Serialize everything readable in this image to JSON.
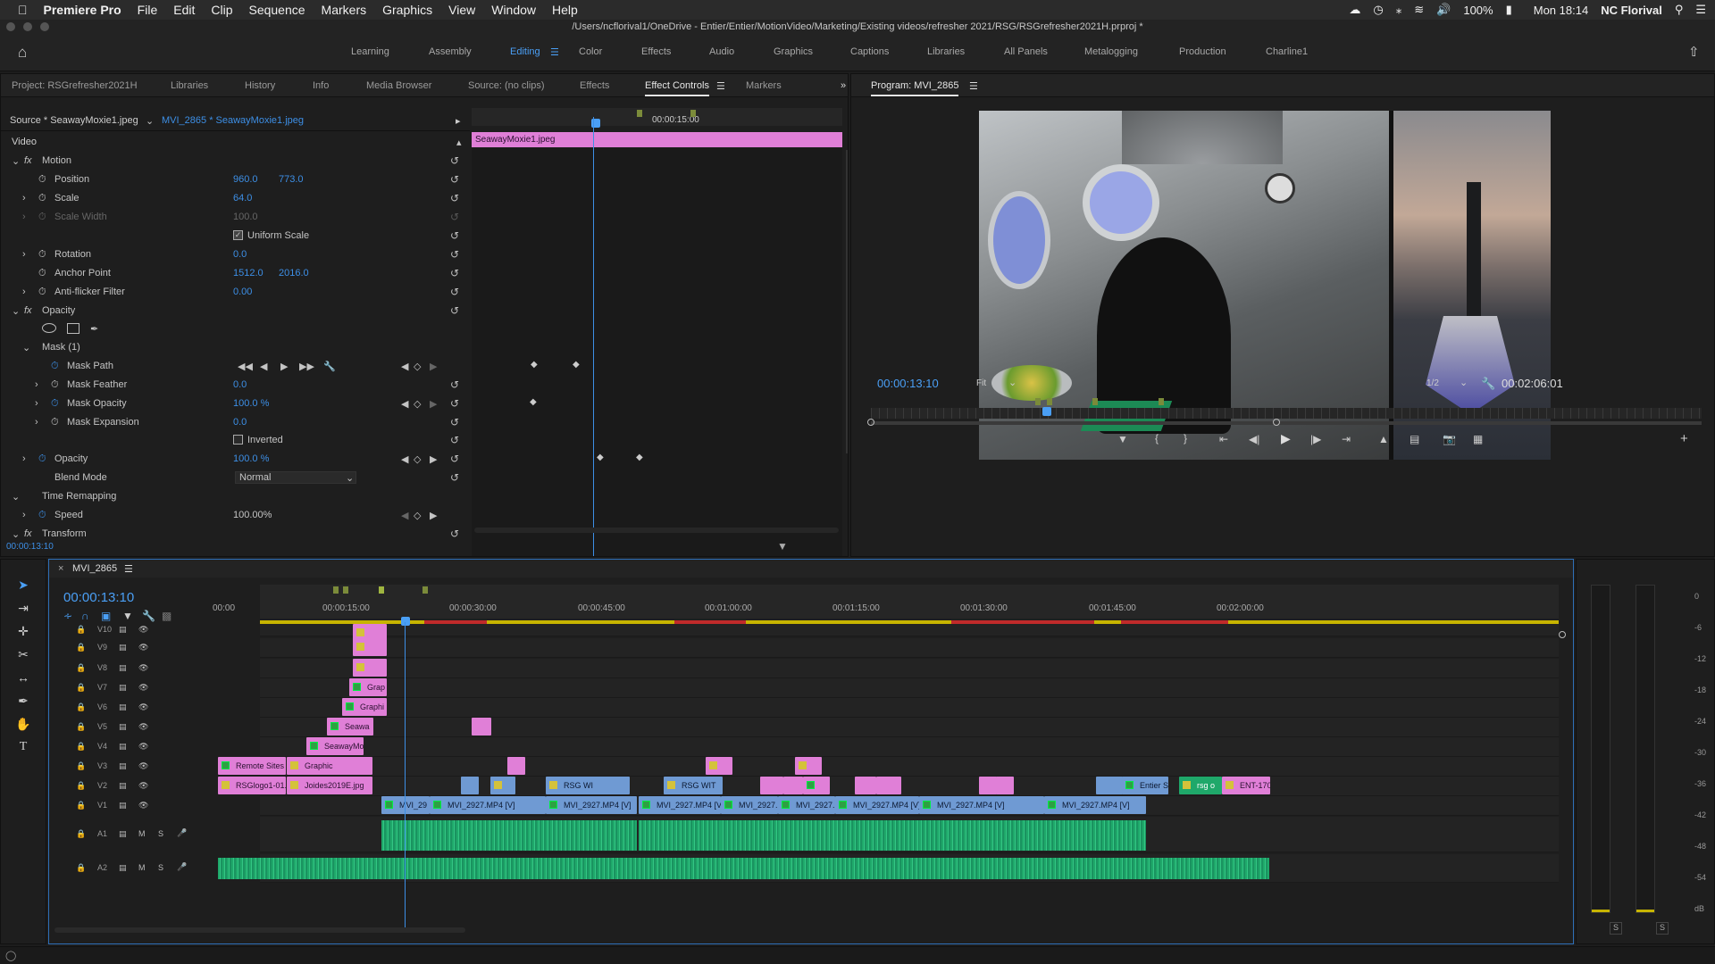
{
  "menubar": {
    "app": "Premiere Pro",
    "items": [
      "File",
      "Edit",
      "Clip",
      "Sequence",
      "Markers",
      "Graphics",
      "View",
      "Window",
      "Help"
    ],
    "battery": "100%",
    "clock": "Mon 18:14",
    "user": "NC Florival"
  },
  "titlebar": {
    "path": "/Users/ncflorival1/OneDrive - Entier/Entier/MotionVideo/Marketing/Existing videos/refresher 2021/RSG/RSGrefresher2021H.prproj *"
  },
  "workspaces": [
    "Learning",
    "Assembly",
    "Editing",
    "Color",
    "Effects",
    "Audio",
    "Graphics",
    "Captions",
    "Libraries",
    "All Panels",
    "Metalogging",
    "Production",
    "Charline1"
  ],
  "workspace_active": "Editing",
  "left_tabs": [
    "Project: RSGrefresher2021H",
    "Libraries",
    "History",
    "Info",
    "Media Browser",
    "Source: (no clips)",
    "Effects",
    "Effect Controls",
    "Markers"
  ],
  "left_tab_active": "Effect Controls",
  "effect_controls": {
    "source_label": "Source * SeawayMoxie1.jpeg",
    "sequence_clip": "MVI_2865 * SeawayMoxie1.jpeg",
    "timecode_head": "00:00:15:00",
    "clip_name": "SeawayMoxie1.jpeg",
    "video_label": "Video",
    "motion": "Motion",
    "position_label": "Position",
    "position_x": "960.0",
    "position_y": "773.0",
    "scale_label": "Scale",
    "scale": "64.0",
    "scale_width_label": "Scale Width",
    "scale_width": "100.0",
    "uniform_scale": "Uniform Scale",
    "rotation_label": "Rotation",
    "rotation": "0.0",
    "anchor_label": "Anchor Point",
    "anchor_x": "1512.0",
    "anchor_y": "2016.0",
    "antiflicker_label": "Anti-flicker Filter",
    "antiflicker": "0.00",
    "opacity_section": "Opacity",
    "mask_label": "Mask (1)",
    "mask_path": "Mask Path",
    "mask_feather_label": "Mask Feather",
    "mask_feather": "0.0",
    "mask_opacity_label": "Mask Opacity",
    "mask_opacity": "100.0 %",
    "mask_expansion_label": "Mask Expansion",
    "mask_expansion": "0.0",
    "inverted": "Inverted",
    "opacity_label": "Opacity",
    "opacity": "100.0 %",
    "blend_label": "Blend Mode",
    "blend": "Normal",
    "time_remap": "Time Remapping",
    "speed_label": "Speed",
    "speed": "100.00%",
    "transform": "Transform",
    "current_time": "00:00:13:10"
  },
  "program": {
    "title": "Program: MVI_2865",
    "timecode": "00:00:13:10",
    "fit": "Fit",
    "resolution": "1/2",
    "duration": "00:02:06:01"
  },
  "timeline": {
    "sequence": "MVI_2865",
    "timecode": "00:00:13:10",
    "ruler": [
      "00:00",
      "00:00:15:00",
      "00:00:30:00",
      "00:00:45:00",
      "00:01:00:00",
      "00:01:15:00",
      "00:01:30:00",
      "00:01:45:00",
      "00:02:00:00"
    ],
    "tracks": [
      "V10",
      "V9",
      "V8",
      "V7",
      "V6",
      "V5",
      "V4",
      "V3",
      "V2",
      "V1",
      "A1",
      "A2"
    ],
    "clips": {
      "grap": "Grap",
      "graphi": "Graphi",
      "seawa": "Seawa",
      "seawaymo": "SeawayMo",
      "remote": "Remote Sites",
      "graphic": "Graphic",
      "rsglogo": "RSGlogo1-01.p",
      "joides": "Joides2019E.jpg",
      "rsgwi": "RSG WI",
      "rsgwit": "RSG WIT",
      "entier": "Entier S",
      "rsgo": "rsg o",
      "ent": "ENT-17097",
      "mvi29": "MVI_29",
      "mvi1": "MVI_2927.MP4 [V]",
      "mvi2": "MVI_2927.MP4 [V]",
      "mvi3": "MVI_2927.MP4 [V]",
      "mvi4": "MVI_2927.",
      "mvi5": "MVI_2927.",
      "mvi6": "MVI_2927.MP4 [V]",
      "mvi7": "MVI_2927.MP4 [V]",
      "mvi8": "MVI_2927.MP4 [V]"
    }
  },
  "meter_labels": [
    "0",
    "-6",
    "-12",
    "-18",
    "-24",
    "-30",
    "-36",
    "-42",
    "-48",
    "-54",
    "dB"
  ],
  "meter_solo": [
    "S",
    "S"
  ],
  "icons": {
    "m": "M",
    "s": "S"
  }
}
